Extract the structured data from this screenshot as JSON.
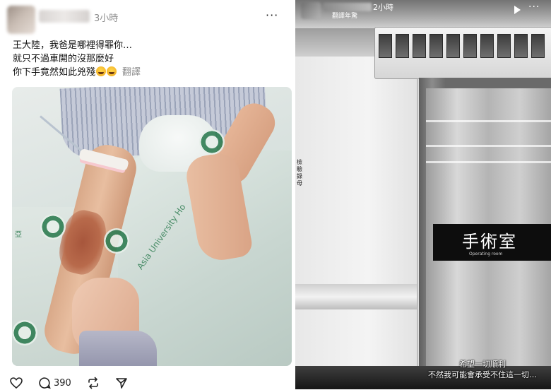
{
  "post": {
    "time": "3小時",
    "menu_glyph": "···",
    "text_lines": [
      "王大陸，我爸是哪裡得罪你…",
      "就只不過車開的沒那麼好",
      "你下手竟然如此兇殘"
    ],
    "emojis": [
      "crying-face-emoji",
      "crying-face-emoji"
    ],
    "translate_label": "翻譯",
    "photo": {
      "sheet_print": "Asia University Ho",
      "side_text": "亞"
    },
    "actions": {
      "like_icon": "heart-icon",
      "comment_icon": "comment-icon",
      "comment_count": "390",
      "repost_icon": "repost-icon",
      "share_icon": "send-icon"
    }
  },
  "story": {
    "time": "2小時",
    "translate_label": "翻譯年驚",
    "play_icon": "play-icon",
    "menu_glyph": "···",
    "wall_sign": "檢驗錄母",
    "door_sign": "手術室",
    "door_sign_sub": "Operating room",
    "caption_lines": [
      "希望一切順利",
      "不然我可能會承受不住這一切…"
    ]
  },
  "colors": {
    "meta_gray": "#8e8e8e",
    "hospital_green": "#2f7d52",
    "text": "#111111"
  }
}
